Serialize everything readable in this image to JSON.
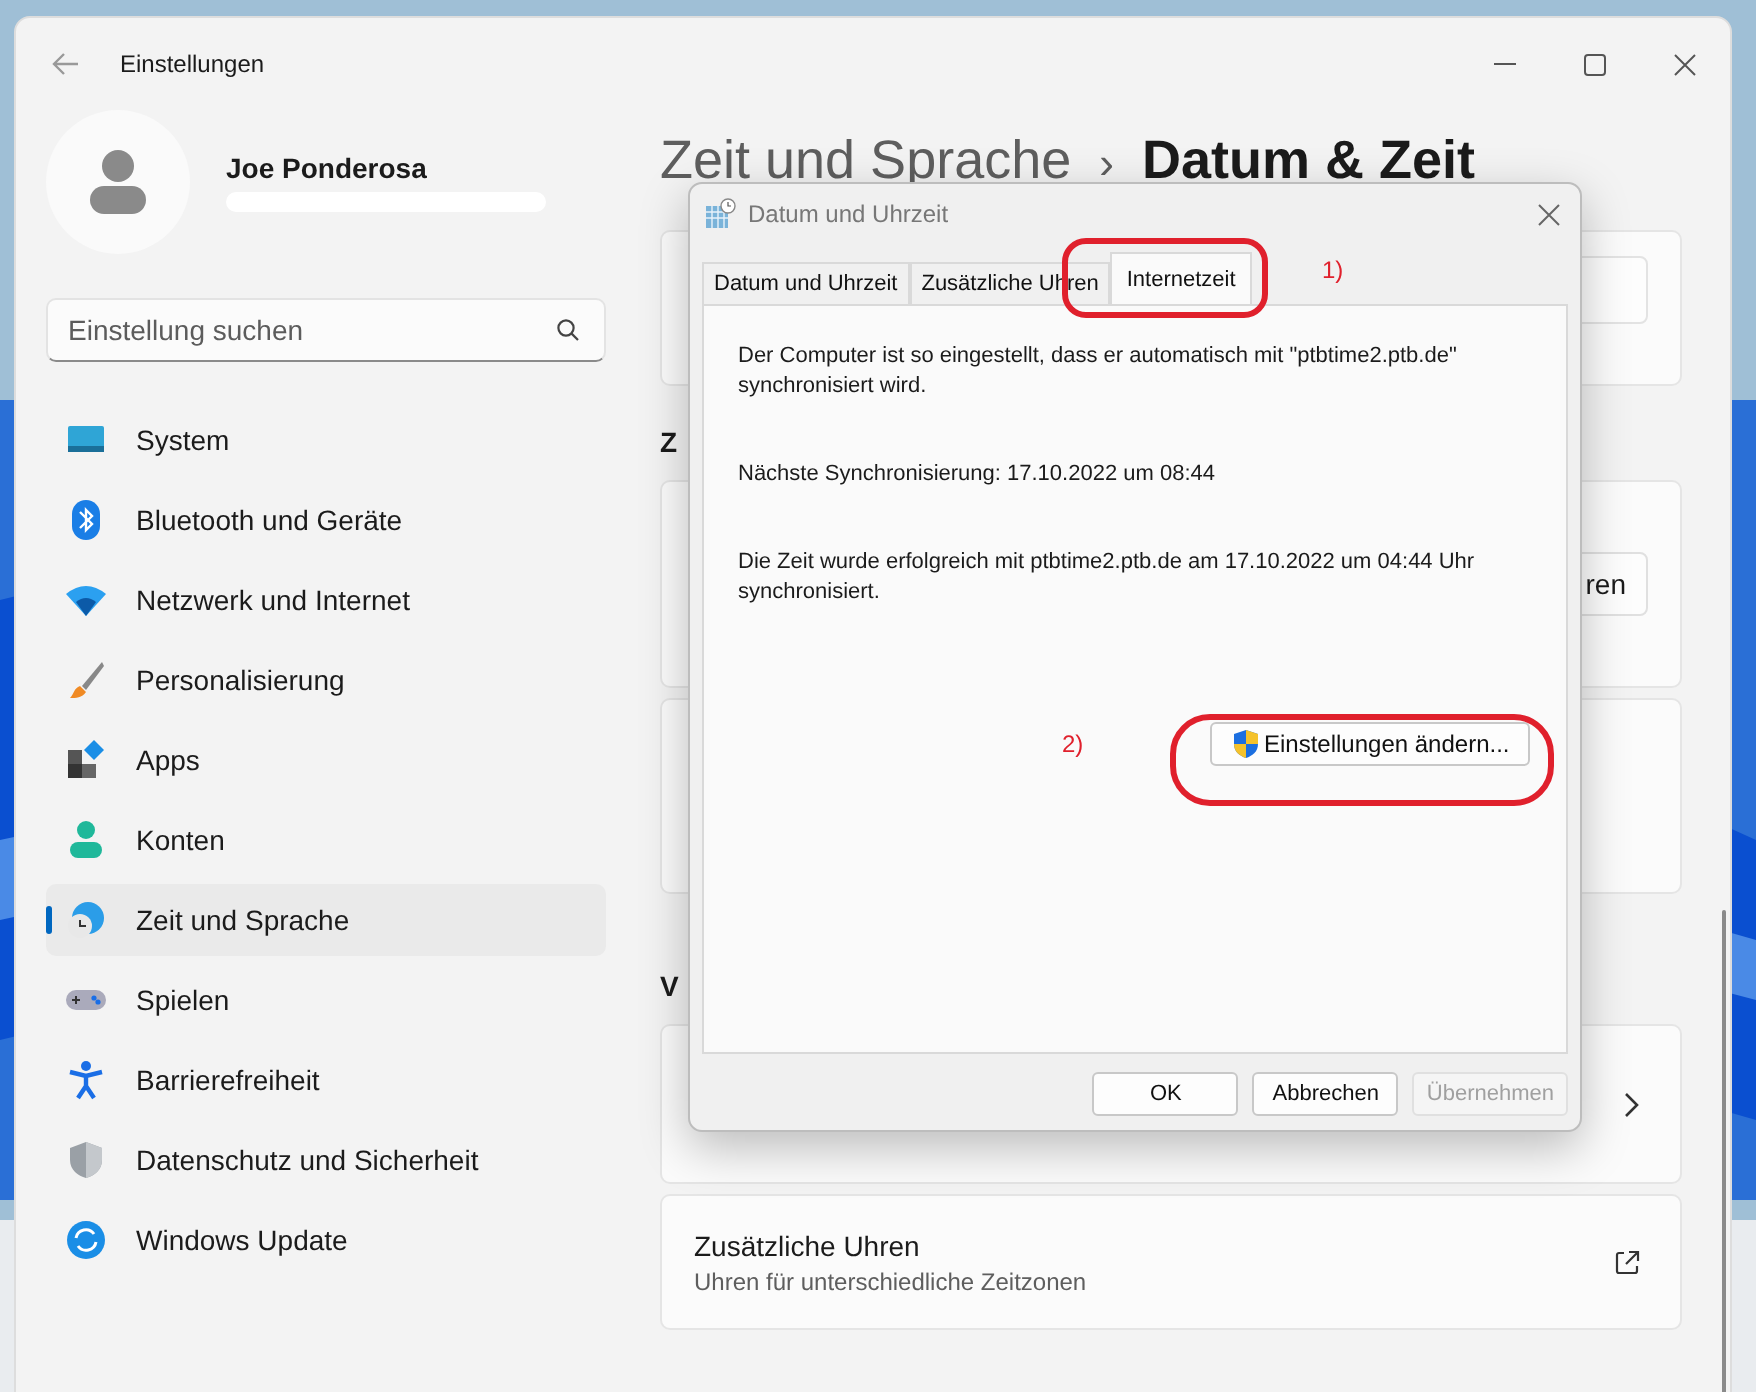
{
  "window": {
    "title": "Einstellungen"
  },
  "profile": {
    "name": "Joe Ponderosa"
  },
  "search": {
    "placeholder": "Einstellung suchen"
  },
  "sidebar": {
    "items": [
      {
        "label": "System",
        "selected": false
      },
      {
        "label": "Bluetooth und Geräte",
        "selected": false
      },
      {
        "label": "Netzwerk und Internet",
        "selected": false
      },
      {
        "label": "Personalisierung",
        "selected": false
      },
      {
        "label": "Apps",
        "selected": false
      },
      {
        "label": "Konten",
        "selected": false
      },
      {
        "label": "Zeit und Sprache",
        "selected": true
      },
      {
        "label": "Spielen",
        "selected": false
      },
      {
        "label": "Barrierefreiheit",
        "selected": false
      },
      {
        "label": "Datenschutz und Sicherheit",
        "selected": false
      },
      {
        "label": "Windows Update",
        "selected": false
      }
    ]
  },
  "breadcrumb": {
    "parent": "Zeit und Sprache",
    "separator": "›",
    "current": "Datum & Zeit"
  },
  "sections": [
    {
      "heading": "Z"
    },
    {
      "heading": "V"
    }
  ],
  "partial_button": "ren",
  "extra_clocks_card": {
    "title": "Zusätzliche Uhren",
    "subtitle": "Uhren für unterschiedliche Zeitzonen"
  },
  "dialog": {
    "title": "Datum und Uhrzeit",
    "tabs": [
      {
        "label": "Datum und Uhrzeit",
        "selected": false
      },
      {
        "label": "Zusätzliche Uhren",
        "selected": false
      },
      {
        "label": "Internetzeit",
        "selected": true
      }
    ],
    "paragraphs": [
      "Der Computer ist so eingestellt, dass er automatisch mit \"ptbtime2.ptb.de\" synchronisiert wird.",
      "Nächste Synchronisierung: 17.10.2022 um 08:44",
      "Die Zeit wurde erfolgreich mit ptbtime2.ptb.de am 17.10.2022 um 04:44 Uhr synchronisiert."
    ],
    "change_button": "Einstellungen ändern...",
    "buttons": [
      {
        "label": "OK",
        "disabled": false
      },
      {
        "label": "Abbrechen",
        "disabled": false
      },
      {
        "label": "Übernehmen",
        "disabled": true
      }
    ]
  },
  "annotations": [
    {
      "label": "1)"
    },
    {
      "label": "2)"
    }
  ]
}
